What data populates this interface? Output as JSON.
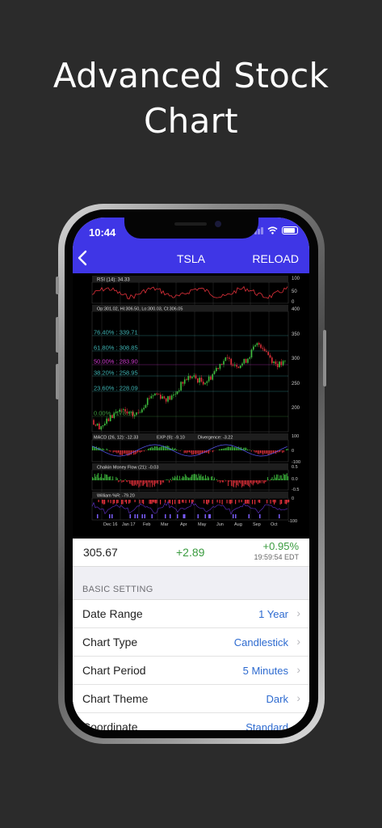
{
  "headline": [
    "Advanced Stock",
    "Chart"
  ],
  "status_bar": {
    "time": "10:44"
  },
  "nav": {
    "title": "TSLA",
    "back_icon": "chevron-left-icon",
    "reload_label": "RELOAD"
  },
  "chart": {
    "rsi_label": "RSI (14): 34.33",
    "rsi_axis": [
      "100",
      "50",
      "0"
    ],
    "ohlc_label": "Op:301.02, Hi:306.50, Lo:300.03, Cl:306.05",
    "fib_levels": [
      {
        "label": "76.40% : 339.71",
        "color": "#3fb6b6"
      },
      {
        "label": "61.80% : 308.85",
        "color": "#3fb6b6"
      },
      {
        "label": "50.00% : 283.90",
        "color": "#d63bd6"
      },
      {
        "label": "38.20% : 258.95",
        "color": "#3fb6b6"
      },
      {
        "label": "23.60% : 228.09",
        "color": "#3fb6b6"
      },
      {
        "label": "0.00% : 178.19",
        "color": "#3e9b3e"
      }
    ],
    "price_axis": [
      "400",
      "350",
      "300",
      "250",
      "200"
    ],
    "macd_label": "MACD (26, 12): -12.33",
    "exp_label": "EXP (9): -9.10",
    "div_label": "Divergence: -3.22",
    "macd_axis": [
      "100",
      "0",
      "-100"
    ],
    "cmf_label": "Chaikin Money Flow (21): -0.03",
    "cmf_axis": [
      "0.5",
      "0.0",
      "-0.5"
    ],
    "wr_label": "William %R: -79.20",
    "wr_axis": [
      "0",
      "-100"
    ],
    "months": [
      "Dec 16",
      "Jan 17",
      "Feb",
      "Mar",
      "Apr",
      "May",
      "Jun",
      "Aug",
      "Sep",
      "Oct"
    ],
    "colors": {
      "up": "#3fbf3f",
      "down": "#e0303a",
      "rsi": "#e0303a",
      "macd": "#5a5aff",
      "grid": "#333333"
    }
  },
  "quote": {
    "price": "305.67",
    "change": "+2.89",
    "percent": "+0.95%",
    "time": "19:59:54 EDT"
  },
  "settings": {
    "section": "BASIC SETTING",
    "rows": [
      {
        "label": "Date Range",
        "value": "1 Year"
      },
      {
        "label": "Chart Type",
        "value": "Candlestick"
      },
      {
        "label": "Chart Period",
        "value": "5 Minutes"
      },
      {
        "label": "Chart Theme",
        "value": "Dark"
      },
      {
        "label": "Coordinate",
        "value": "Standard"
      }
    ]
  }
}
